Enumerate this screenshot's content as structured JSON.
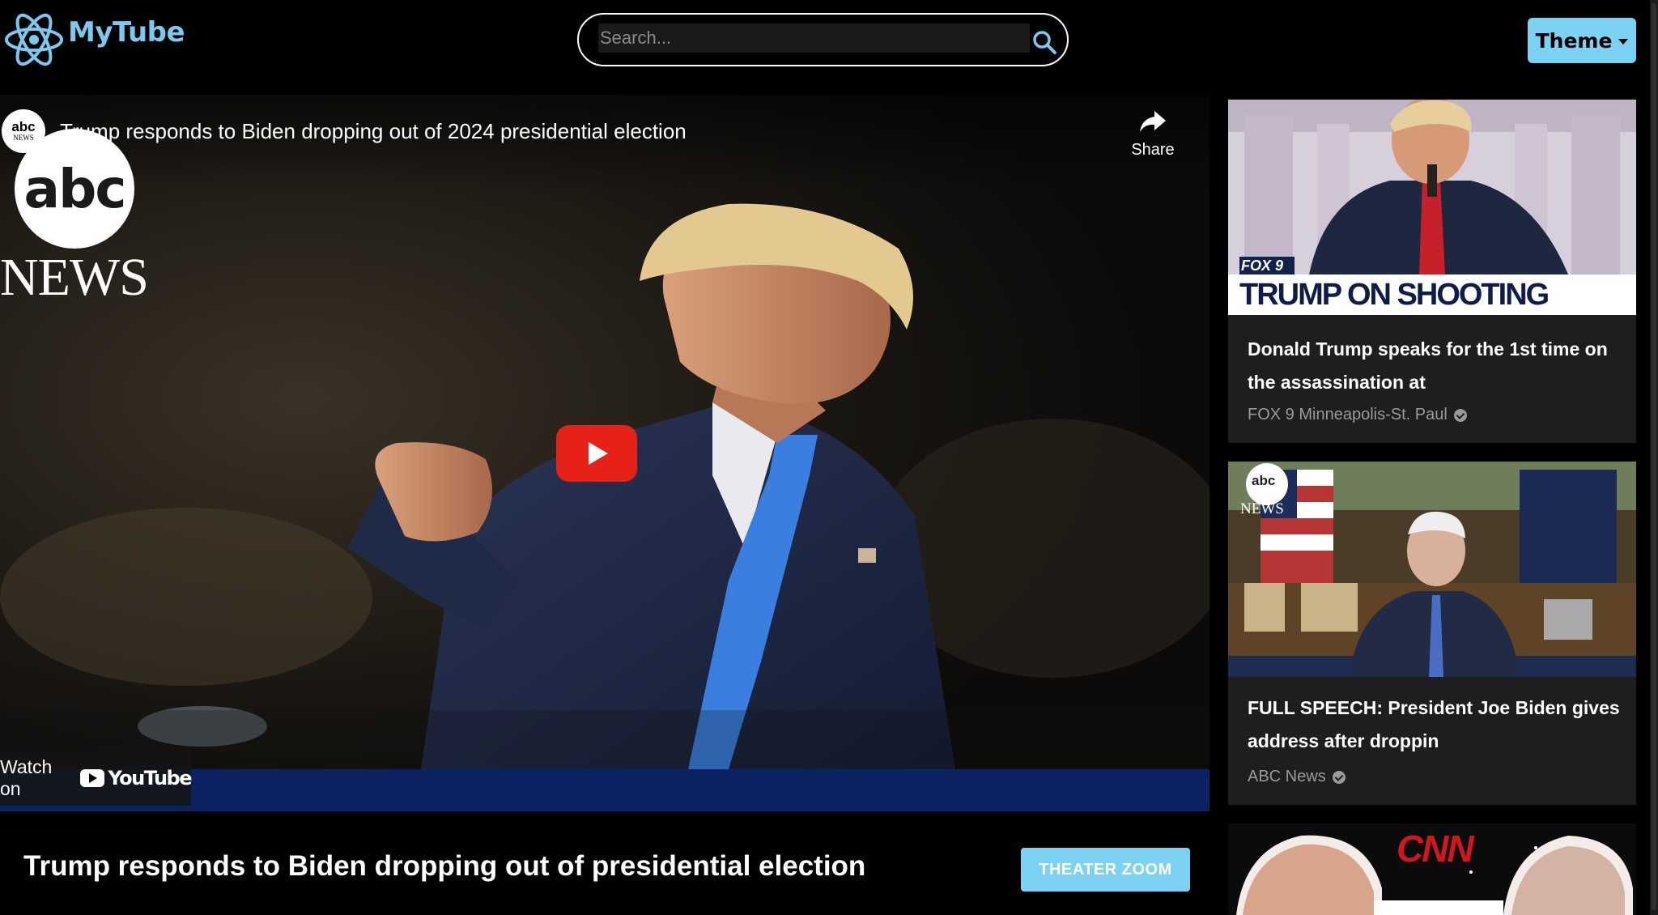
{
  "app": {
    "name": "MyTube",
    "theme_label": "Theme"
  },
  "search": {
    "placeholder": "Search...",
    "value": ""
  },
  "player": {
    "channel_avatar_top": "abc",
    "channel_avatar_bottom": "NEWS",
    "video_title": "Trump responds to Biden dropping out of 2024 presidential election",
    "share_label": "Share",
    "watermark_top": "abc",
    "watermark_bottom": "NEWS",
    "watch_on_label": "Watch on",
    "youtube_wordmark": "YouTube"
  },
  "main": {
    "title": "Trump responds to Biden dropping out of presidential election",
    "theater_button": "THEATER ZOOM"
  },
  "sidebar": {
    "videos": [
      {
        "title": "Donald Trump speaks for the 1st time on the assassination at",
        "channel": "FOX 9 Minneapolis-St. Paul",
        "verified": true,
        "thumb_badge": "FOX 9",
        "thumb_headline": "TRUMP ON SHOOTING"
      },
      {
        "title": "FULL SPEECH: President Joe Biden gives address after droppin",
        "channel": "ABC News",
        "verified": true,
        "thumb_badge_top": "abc",
        "thumb_badge_bottom": "NEWS"
      },
      {
        "thumb_brand": "CNN"
      }
    ]
  },
  "colors": {
    "accent": "#7cd2f2",
    "logo": "#7cc8ee",
    "play_button": "#e62117",
    "card_bg": "#1e1e1e"
  },
  "icons": [
    "atom-logo-icon",
    "search-icon",
    "caret-down-icon",
    "share-icon",
    "play-icon",
    "youtube-logo-icon",
    "verified-icon"
  ]
}
